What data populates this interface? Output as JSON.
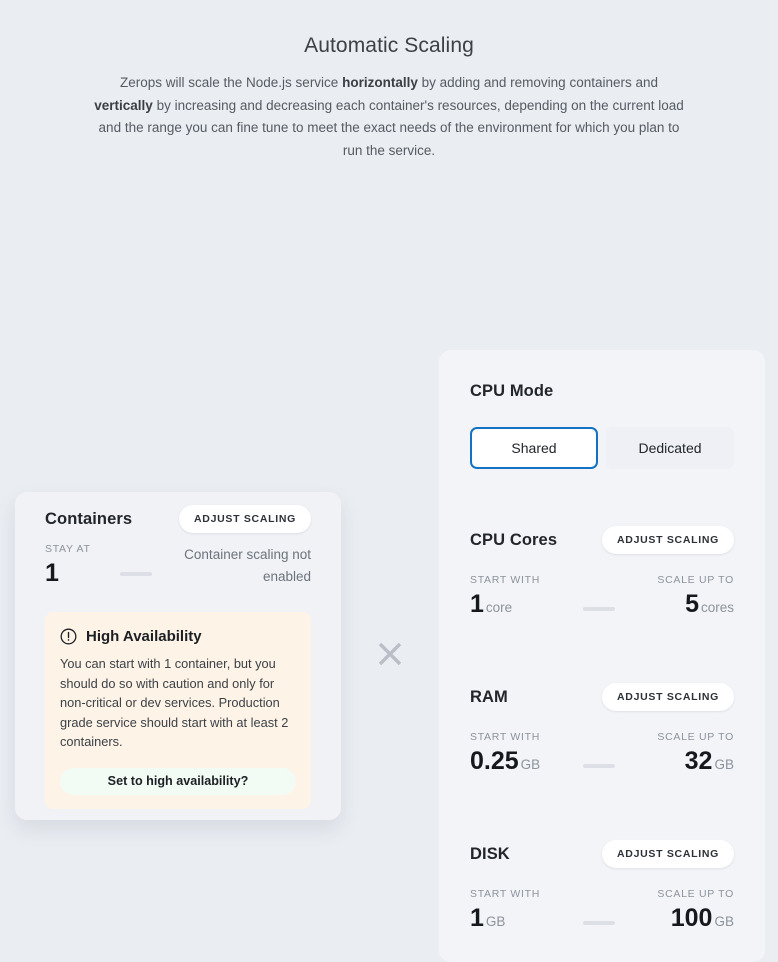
{
  "header": {
    "title": "Automatic Scaling",
    "desc_part1": "Zerops will scale the Node.js service ",
    "desc_bold1": "horizontally",
    "desc_part2": " by adding and removing containers and ",
    "desc_bold2": "vertically",
    "desc_part3": " by increasing and decreasing each container's resources, depending on the current load and the range you can fine tune to meet the exact needs of the environment for which you plan to run the service."
  },
  "icons": {
    "close": "close-x-icon",
    "warning": "alert-circle-icon"
  },
  "colors": {
    "page_background": "#eaedf2",
    "panel_background": "#f2f4f8",
    "accent_blue": "#1372c4",
    "warning_background": "#fdf3e7",
    "ha_button_background": "#f2fbf4",
    "slider_track": "#dcdfe6",
    "muted_text": "#8d939c"
  },
  "left_panel": {
    "title": "Containers",
    "adjust_label": "ADJUST SCALING",
    "start_label": "STAY AT",
    "start_value": "1",
    "note": "Container scaling not enabled",
    "warning": {
      "title": "High Availability",
      "text": "You can start with 1 container, but you should do so with caution and only for non-critical or dev services. Production grade service should start with at least 2 containers.",
      "button_label": "Set to high availability?"
    }
  },
  "right_panel": {
    "cpu_mode": {
      "title": "CPU Mode",
      "options": [
        {
          "label": "Shared",
          "selected": true
        },
        {
          "label": "Dedicated",
          "selected": false
        }
      ]
    },
    "sections": [
      {
        "title": "CPU Cores",
        "adjust_label": "ADJUST SCALING",
        "start_label": "START WITH",
        "start_value": "1",
        "start_unit": "core",
        "max_label": "SCALE UP TO",
        "max_value": "5",
        "max_unit": "cores"
      },
      {
        "title": "RAM",
        "adjust_label": "ADJUST SCALING",
        "start_label": "START WITH",
        "start_value": "0.25",
        "start_unit": "GB",
        "max_label": "SCALE UP TO",
        "max_value": "32",
        "max_unit": "GB"
      },
      {
        "title": "DISK",
        "adjust_label": "ADJUST SCALING",
        "start_label": "START WITH",
        "start_value": "1",
        "start_unit": "GB",
        "max_label": "SCALE UP TO",
        "max_value": "100",
        "max_unit": "GB"
      }
    ]
  }
}
